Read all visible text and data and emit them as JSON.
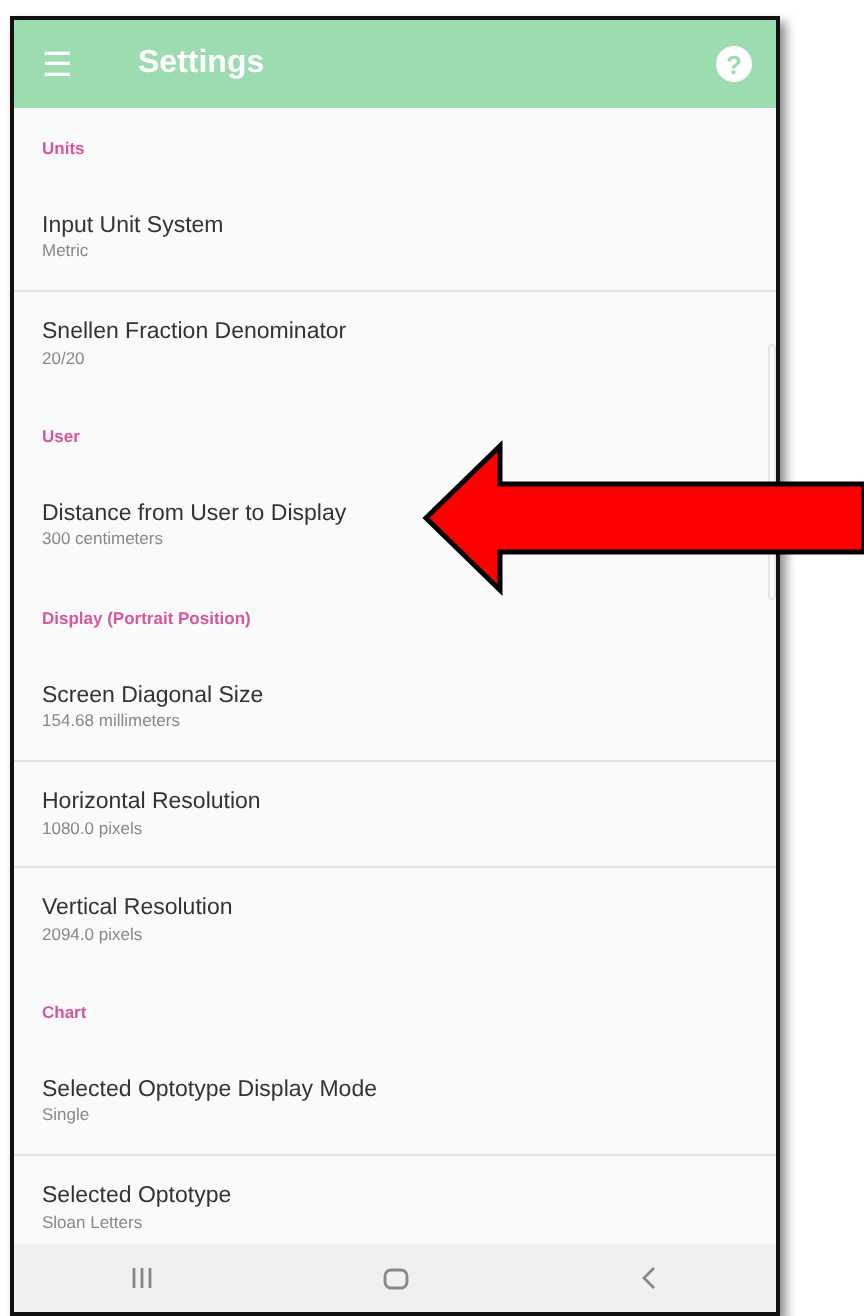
{
  "app_bar": {
    "menu_glyph": "☰",
    "title": "Settings",
    "help_glyph": "?"
  },
  "sections": [
    {
      "header": "Units",
      "items": [
        {
          "title": "Input Unit System",
          "value": "Metric"
        },
        {
          "title": "Snellen Fraction Denominator",
          "value": "20/20"
        }
      ]
    },
    {
      "header": "User",
      "items": [
        {
          "title": "Distance from User to Display",
          "value": "300 centimeters"
        }
      ]
    },
    {
      "header": "Display (Portrait Position)",
      "items": [
        {
          "title": "Screen Diagonal Size",
          "value": "154.68 millimeters"
        },
        {
          "title": "Horizontal Resolution",
          "value": "1080.0 pixels"
        },
        {
          "title": "Vertical Resolution",
          "value": "2094.0 pixels"
        }
      ]
    },
    {
      "header": "Chart",
      "items": [
        {
          "title": "Selected Optotype Display Mode",
          "value": "Single"
        },
        {
          "title": "Selected Optotype",
          "value": "Sloan Letters"
        }
      ]
    }
  ],
  "nav_bar": [
    {
      "kind": "recents"
    },
    {
      "kind": "home"
    },
    {
      "kind": "back"
    }
  ],
  "annotation": {
    "kind": "arrow"
  }
}
